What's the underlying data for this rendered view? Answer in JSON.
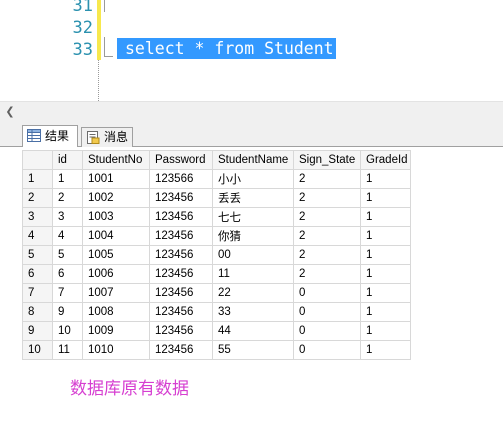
{
  "editor": {
    "line_numbers": [
      "31",
      "32",
      "33"
    ],
    "selected_code": "select * from Student"
  },
  "tabs": [
    {
      "label": "结果",
      "icon": "grid-icon"
    },
    {
      "label": "消息",
      "icon": "message-icon"
    }
  ],
  "grid": {
    "columns": [
      "id",
      "StudentNo",
      "Password",
      "StudentName",
      "Sign_State",
      "GradeId"
    ],
    "rows": [
      {
        "n": "1",
        "cells": [
          "1",
          "1001",
          "123566",
          "小小",
          "2",
          "1"
        ]
      },
      {
        "n": "2",
        "cells": [
          "2",
          "1002",
          "123456",
          "丢丢",
          "2",
          "1"
        ]
      },
      {
        "n": "3",
        "cells": [
          "3",
          "1003",
          "123456",
          "七七",
          "2",
          "1"
        ]
      },
      {
        "n": "4",
        "cells": [
          "4",
          "1004",
          "123456",
          "你猜",
          "2",
          "1"
        ]
      },
      {
        "n": "5",
        "cells": [
          "5",
          "1005",
          "123456",
          "00",
          "2",
          "1"
        ]
      },
      {
        "n": "6",
        "cells": [
          "6",
          "1006",
          "123456",
          "11",
          "2",
          "1"
        ]
      },
      {
        "n": "7",
        "cells": [
          "7",
          "1007",
          "123456",
          "22",
          "0",
          "1"
        ]
      },
      {
        "n": "8",
        "cells": [
          "9",
          "1008",
          "123456",
          "33",
          "0",
          "1"
        ]
      },
      {
        "n": "9",
        "cells": [
          "10",
          "1009",
          "123456",
          "44",
          "0",
          "1"
        ]
      },
      {
        "n": "10",
        "cells": [
          "11",
          "1010",
          "123456",
          "55",
          "0",
          "1"
        ]
      }
    ]
  },
  "note": "数据库原有数据",
  "colors": {
    "selection": "#3399ff",
    "line_number": "#2b91af",
    "note": "#d63fd1",
    "change_bar": "#f7e84d"
  }
}
